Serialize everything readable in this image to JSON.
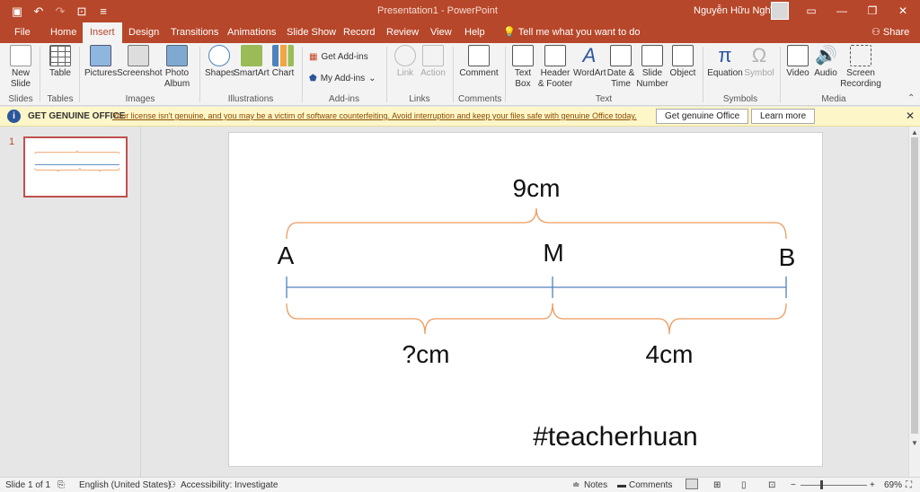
{
  "window": {
    "title": "Presentation1 - PowerPoint",
    "user": "Nguyễn Hữu Nghĩa"
  },
  "tabs": [
    "File",
    "Home",
    "Insert",
    "Design",
    "Transitions",
    "Animations",
    "Slide Show",
    "Record",
    "Review",
    "View",
    "Help"
  ],
  "active_tab": "Insert",
  "tell_me": "Tell me what you want to do",
  "share": "Share",
  "ribbon": {
    "buttons": {
      "new_slide": "New Slide",
      "table": "Table",
      "pictures": "Pictures",
      "screenshot": "Screenshot",
      "photo_album": "Photo Album",
      "shapes": "Shapes",
      "smartart": "SmartArt",
      "chart": "Chart",
      "get_addins": "Get Add-ins",
      "my_addins": "My Add-ins",
      "link": "Link",
      "action": "Action",
      "comment": "Comment",
      "text_box": "Text Box",
      "header_footer": "Header & Footer",
      "wordart": "WordArt",
      "date_time": "Date & Time",
      "slide_number": "Slide Number",
      "object": "Object",
      "equation": "Equation",
      "symbol": "Symbol",
      "video": "Video",
      "audio": "Audio",
      "screen_recording": "Screen Recording"
    },
    "groups": {
      "slides": "Slides",
      "tables": "Tables",
      "images": "Images",
      "illustrations": "Illustrations",
      "addins": "Add-ins",
      "links": "Links",
      "comments": "Comments",
      "text": "Text",
      "symbols": "Symbols",
      "media": "Media"
    }
  },
  "notice": {
    "title": "GET GENUINE OFFICE",
    "message": "Your license isn't genuine, and you may be a victim of software counterfeiting. Avoid interruption and keep your files safe with genuine Office today.",
    "primary_button": "Get genuine Office",
    "secondary_button": "Learn more"
  },
  "thumbnail": {
    "number": "1"
  },
  "slide": {
    "total_label": "9cm",
    "point_a": "A",
    "point_m": "M",
    "point_b": "B",
    "am_label": "?cm",
    "mb_label": "4cm",
    "hashtag": "#teacherhuan"
  },
  "status": {
    "slide_info": "Slide 1 of 1",
    "language": "English (United States)",
    "accessibility": "Accessibility: Investigate",
    "notes": "Notes",
    "comments": "Comments",
    "zoom": "69%"
  },
  "colors": {
    "accent": "#b7472a",
    "brace": "#ed9b5e",
    "segment": "#4f81bd"
  }
}
